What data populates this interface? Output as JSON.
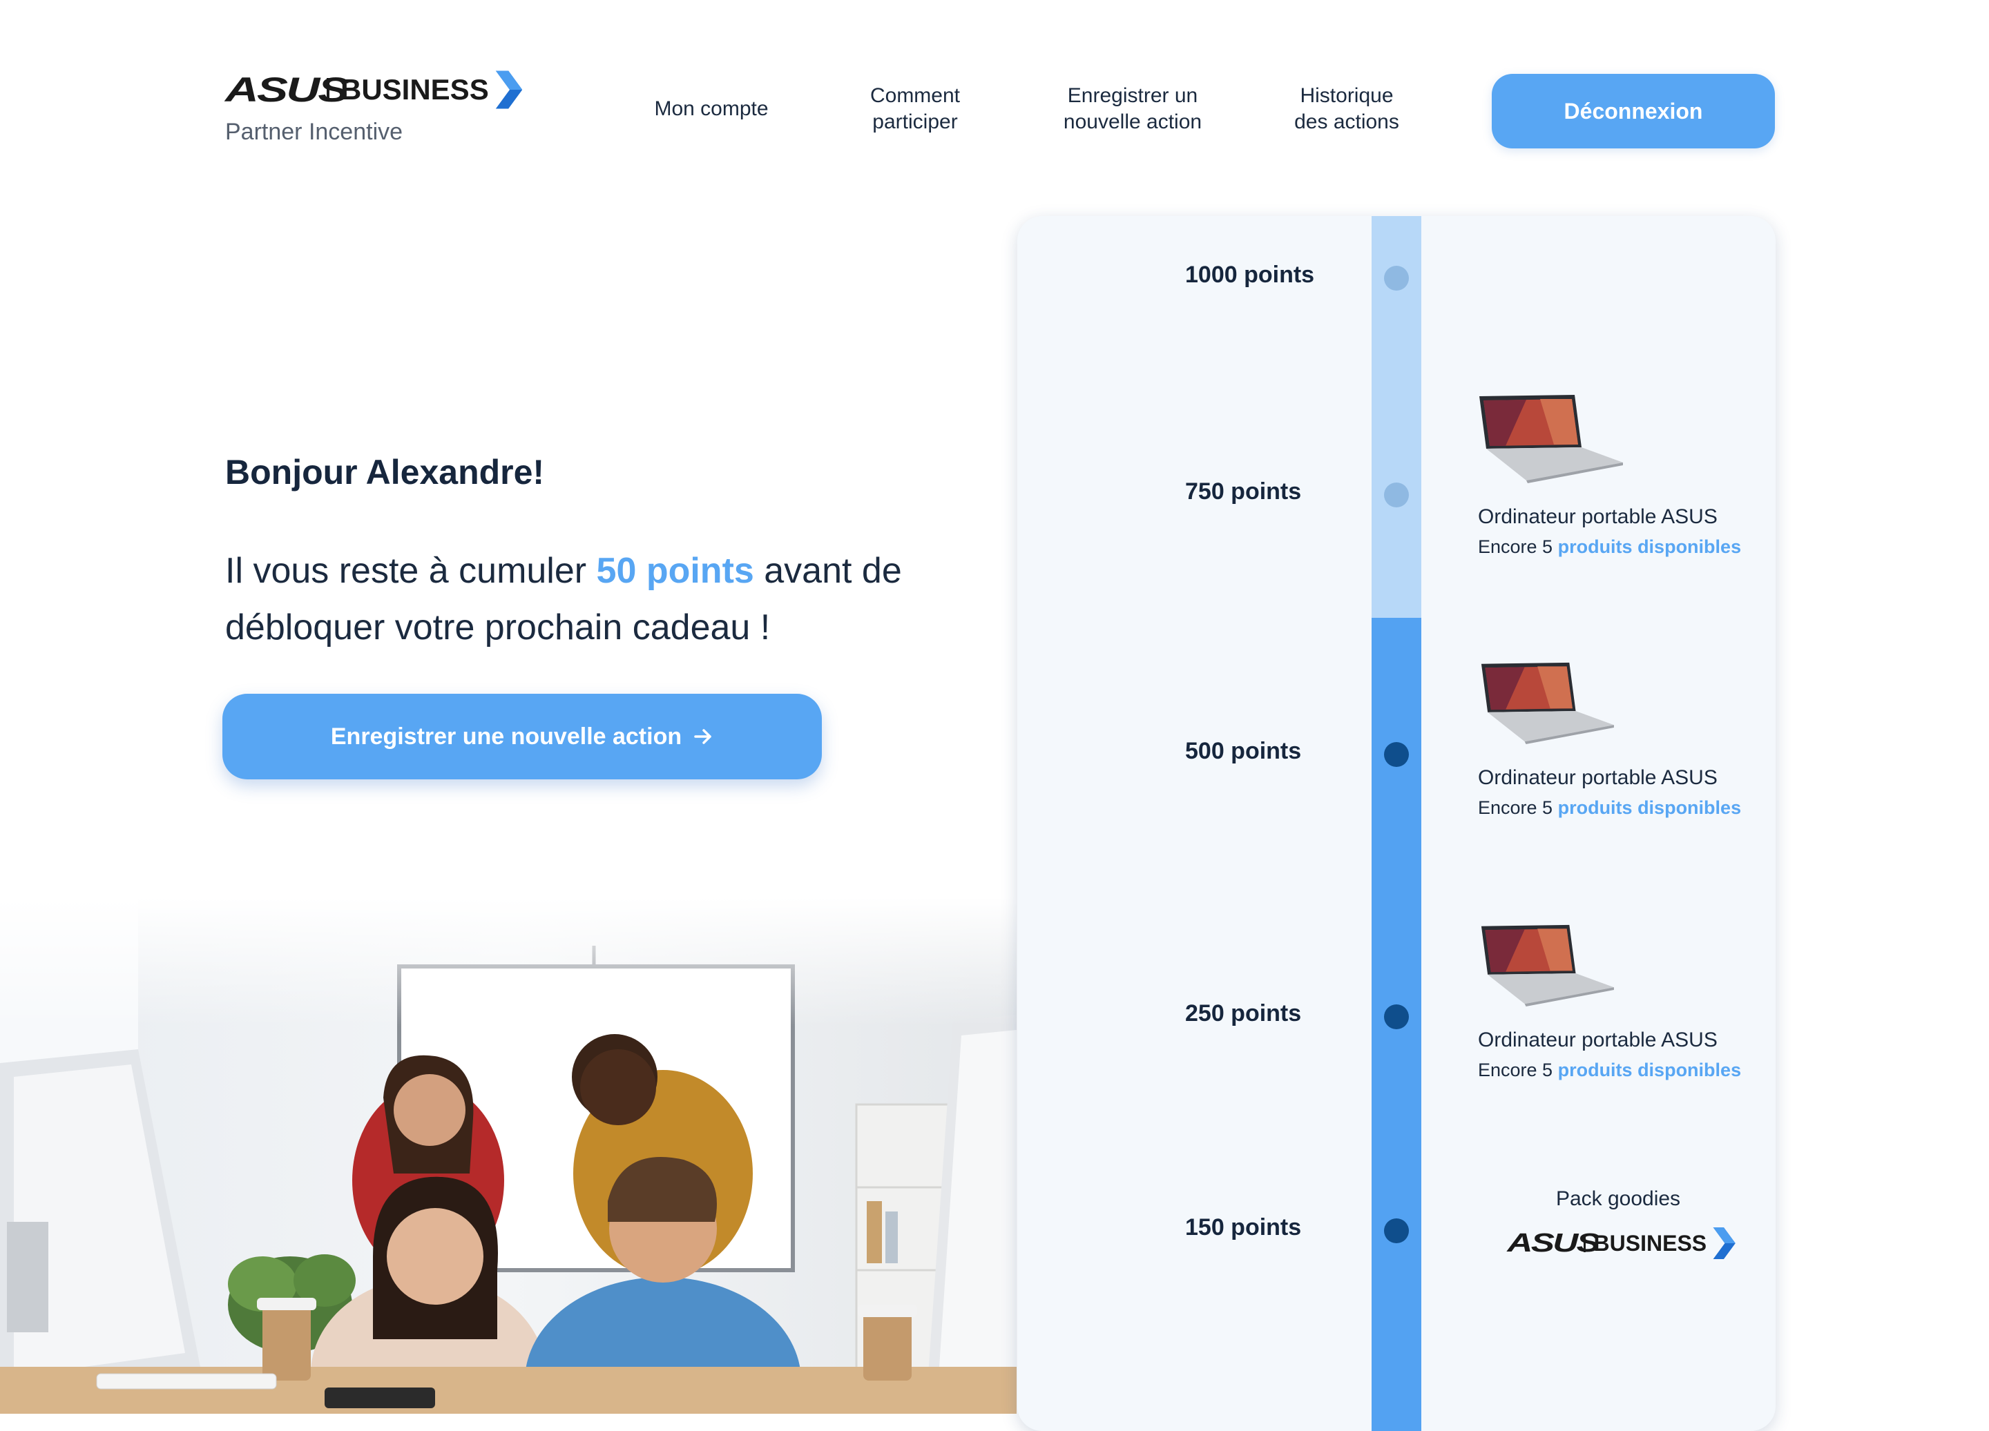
{
  "brand": {
    "asus": "ASUS",
    "business": "BUSINESS",
    "subtitle": "Partner Incentive"
  },
  "nav": {
    "account": "Mon compte",
    "how_1": "Comment",
    "how_2": "participer",
    "register_1": "Enregistrer un",
    "register_2": "nouvelle action",
    "history_1": "Historique",
    "history_2": "des actions",
    "logout": "Déconnexion"
  },
  "hero": {
    "greeting": "Bonjour Alexandre!",
    "message_before": "Il vous reste à cumuler ",
    "message_highlight": "50 points",
    "message_after": " avant de débloquer votre prochain cadeau !",
    "cta": "Enregistrer une nouvelle action"
  },
  "timeline": {
    "progress_points": 100,
    "levels": [
      {
        "label": "1000 points"
      },
      {
        "label": "750 points"
      },
      {
        "label": "500 points"
      },
      {
        "label": "250 points"
      },
      {
        "label": "150 points"
      }
    ]
  },
  "rewards": [
    {
      "name": "Ordinateur portable ASUS",
      "stock_prefix": "Encore 5 ",
      "stock_link": "produits disponibles"
    },
    {
      "name": "Ordinateur portable ASUS",
      "stock_prefix": "Encore 5 ",
      "stock_link": "produits disponibles"
    },
    {
      "name": "Ordinateur portable ASUS",
      "stock_prefix": "Encore 5 ",
      "stock_link": "produits disponibles"
    }
  ],
  "goodies": {
    "name": "Pack goodies",
    "asus": "ASUS",
    "business": "BUSINESS"
  },
  "colors": {
    "accent": "#58a6f3",
    "track_light": "#b7d8f8",
    "track_dark": "#53a2f2",
    "dot_done": "#8fb9e2",
    "dot_todo": "#0f4e8c",
    "text_dark": "#16263d"
  },
  "icons": {
    "cta_arrow": "arrow-right-icon",
    "brand_chevron": "chevron-right-icon"
  }
}
